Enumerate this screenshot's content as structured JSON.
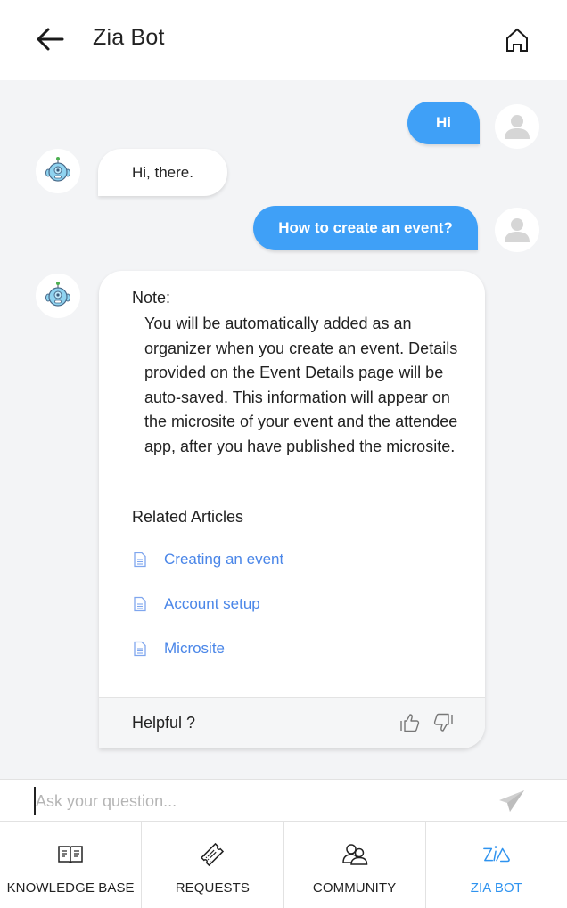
{
  "header": {
    "title": "Zia Bot",
    "back_icon": "arrow-left-icon",
    "home_icon": "home-icon"
  },
  "colors": {
    "user_bubble": "#3fa0f7",
    "link": "#4a86e8",
    "active_nav": "#2f93ef",
    "chat_background": "#f3f4f6"
  },
  "messages": [
    {
      "sender": "user",
      "text": "Hi"
    },
    {
      "sender": "bot",
      "text": "Hi, there."
    },
    {
      "sender": "user",
      "text": "How to create an event?"
    },
    {
      "sender": "bot",
      "note_label": "Note:",
      "note_body": "You will be automatically added as an organizer when you create an event. Details provided on the Event Details page will be auto-saved. This information will appear on the microsite of your event and the attendee app, after you have published the microsite.",
      "related_title": "Related Articles",
      "articles": [
        {
          "title": "Creating an event",
          "icon": "document-icon"
        },
        {
          "title": "Account setup",
          "icon": "document-icon"
        },
        {
          "title": "Microsite",
          "icon": "document-icon"
        }
      ],
      "feedback": {
        "label": "Helpful ?",
        "like_icon": "thumbs-up-icon",
        "dislike_icon": "thumbs-down-icon"
      }
    }
  ],
  "input": {
    "value": "",
    "placeholder": "Ask your question...",
    "send_icon": "paper-plane-icon"
  },
  "nav": [
    {
      "label": "KNOWLEDGE BASE",
      "icon": "book-icon",
      "active": false
    },
    {
      "label": "REQUESTS",
      "icon": "ticket-icon",
      "active": false
    },
    {
      "label": "COMMUNITY",
      "icon": "people-icon",
      "active": false
    },
    {
      "label": "ZIA BOT",
      "icon": "zia-icon",
      "active": true
    }
  ]
}
